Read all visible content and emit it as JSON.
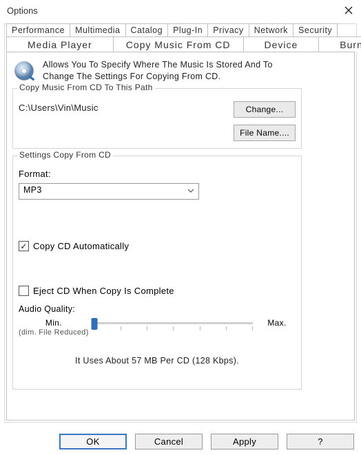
{
  "window": {
    "title": "Options"
  },
  "tabs_row1": [
    "Performance",
    "Multimedia",
    "Catalog",
    "Plug-In",
    "Privacy",
    "Network",
    "Security"
  ],
  "tabs_row2": [
    "Media Player",
    "Copy Music From CD",
    "Device",
    "Burn"
  ],
  "active_tab": "Copy Music From CD",
  "header": {
    "line1": "Allows You To Specify Where The Music Is Stored And To",
    "line2": "Change The Settings For Copying From CD."
  },
  "path_group": {
    "legend": "Copy Music From CD To This Path",
    "path": "C:\\Users\\Vin\\Music",
    "change_btn": "Change...",
    "filename_btn": "File Name...."
  },
  "settings_group": {
    "legend": "Settings Copy From CD",
    "format_label": "Format:",
    "format_value": "MP3",
    "copy_auto": {
      "label": "Copy CD Automatically",
      "checked": true
    },
    "eject": {
      "label": "Eject CD When Copy Is Complete",
      "checked": false
    },
    "audio_quality_label": "Audio Quality:",
    "min_label": "Min.",
    "min_sub": "(dim. File Reduced)",
    "max_label": "Max.",
    "usage": "It Uses About 57 MB Per CD (128 Kbps)."
  },
  "buttons": {
    "ok": "OK",
    "cancel": "Cancel",
    "apply": "Apply",
    "help": "?"
  }
}
